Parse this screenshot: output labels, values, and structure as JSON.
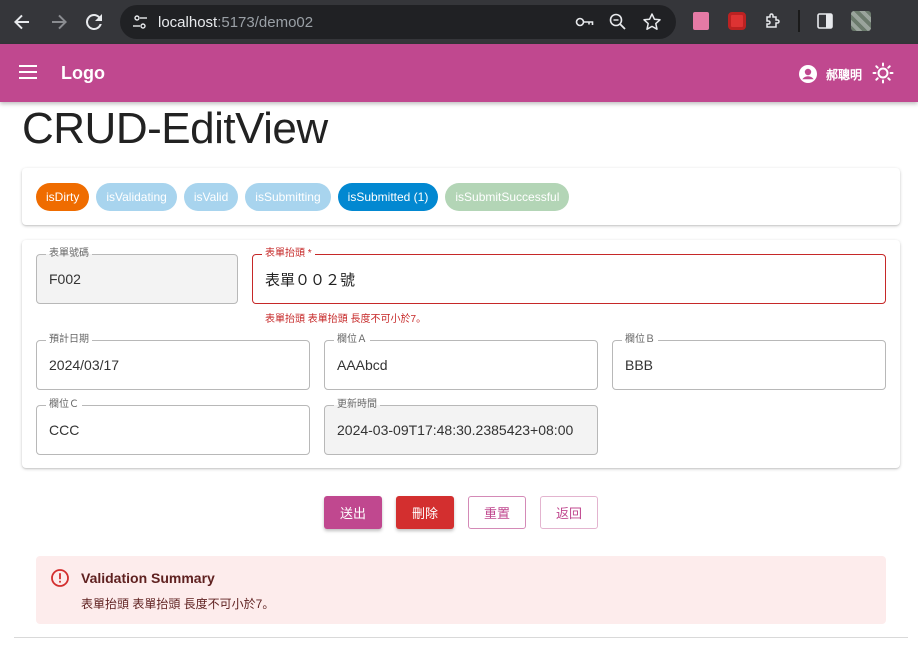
{
  "browser": {
    "url_host": "localhost",
    "url_path": ":5173/demo02"
  },
  "appbar": {
    "logo": "Logo",
    "user_name": "郝聰明",
    "bg_color": "#c0488f"
  },
  "page": {
    "title": "CRUD-EditView"
  },
  "chips": [
    {
      "label": "isDirty",
      "color": "#ef6c00"
    },
    {
      "label": "isValidating",
      "color": "#a8d4ee"
    },
    {
      "label": "isValid",
      "color": "#a8d4ee"
    },
    {
      "label": "isSubmitting",
      "color": "#a8d4ee"
    },
    {
      "label": "isSubmitted (1)",
      "color": "#0288d1"
    },
    {
      "label": "isSubmitSuccessful",
      "color": "#b3d5b6"
    }
  ],
  "form": {
    "form_no": {
      "label": "表單號碼",
      "value": "F002"
    },
    "form_title": {
      "label": "表單抬頭 *",
      "value": "表單００２號",
      "error": "表單抬頭 表單抬頭 長度不可小於7。"
    },
    "planned_date": {
      "label": "預計日期",
      "value": "2024/03/17"
    },
    "field_a": {
      "label": "欄位Ａ",
      "value": "AAAbcd"
    },
    "field_b": {
      "label": "欄位Ｂ",
      "value": "BBB"
    },
    "field_c": {
      "label": "欄位Ｃ",
      "value": "CCC"
    },
    "updated_at": {
      "label": "更新時間",
      "value": "2024-03-09T17:48:30.2385423+08:00"
    }
  },
  "actions": {
    "submit": "送出",
    "delete": "刪除",
    "reset": "重置",
    "back": "返回"
  },
  "alert": {
    "title": "Validation Summary",
    "message": "表單抬頭 表單抬頭 長度不可小於7。"
  },
  "colors": {
    "primary": "#c0488f",
    "error": "#d32f2f",
    "alert_bg": "#fdecec"
  }
}
